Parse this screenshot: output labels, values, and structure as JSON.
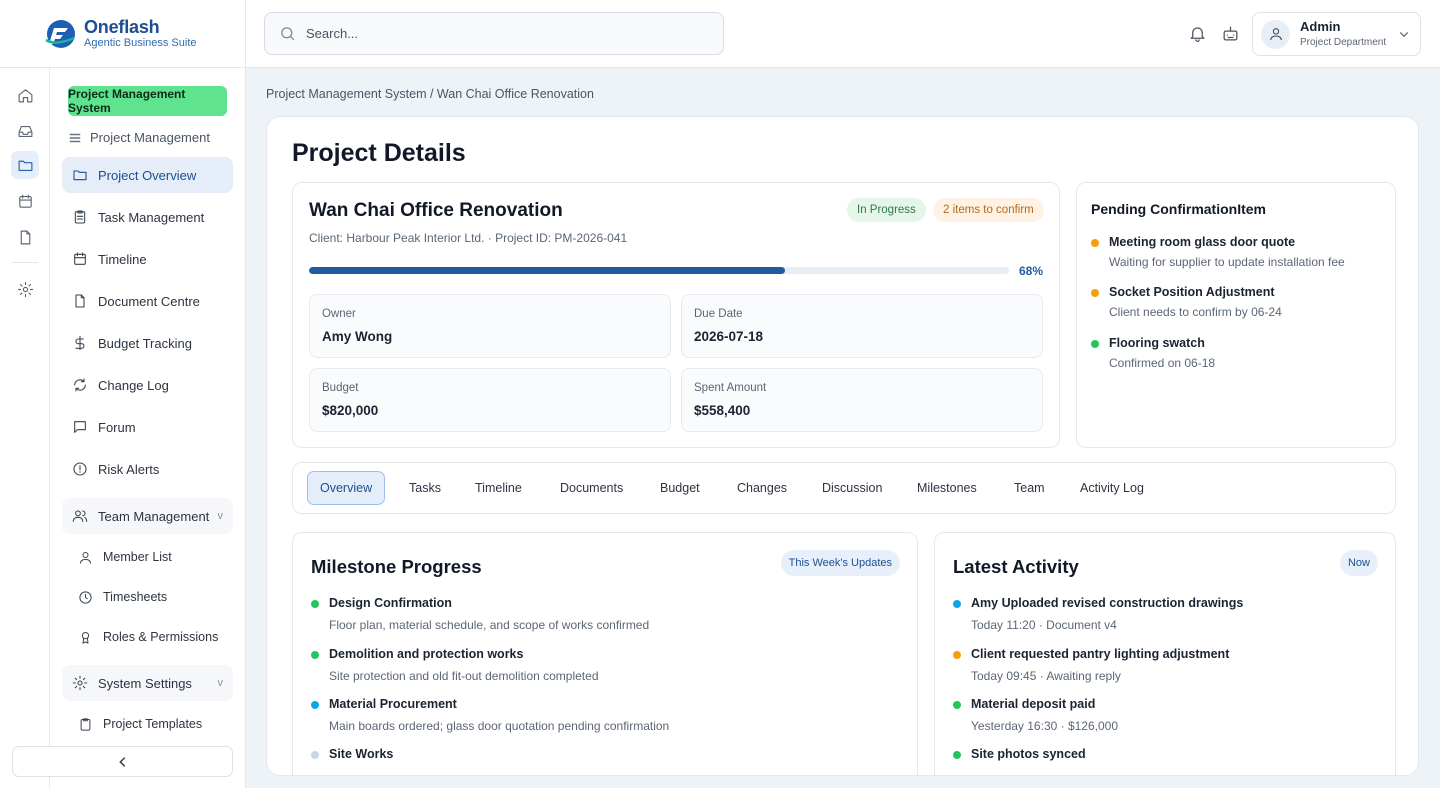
{
  "brand": {
    "name": "Oneflash",
    "tagline": "Agentic Business Suite"
  },
  "search": {
    "placeholder": "Search..."
  },
  "user": {
    "name": "Admin",
    "role": "Project Department"
  },
  "sidebar": {
    "system_badge": "Project Management System",
    "section_title": "Project Management",
    "items": [
      {
        "label": "Project Overview",
        "icon": "folder-icon",
        "active": true
      },
      {
        "label": "Task Management",
        "icon": "clipboard-icon"
      },
      {
        "label": "Timeline",
        "icon": "calendar-icon"
      },
      {
        "label": "Document Centre",
        "icon": "file-icon"
      },
      {
        "label": "Budget Tracking",
        "icon": "dollar-icon"
      },
      {
        "label": "Change Log",
        "icon": "refresh-icon"
      },
      {
        "label": "Forum",
        "icon": "chat-icon"
      },
      {
        "label": "Risk Alerts",
        "icon": "alert-icon"
      }
    ],
    "team_group": {
      "label": "Team Management",
      "chevron": "v",
      "children": [
        "Member List",
        "Timesheets",
        "Roles & Permissions"
      ]
    },
    "settings_group": {
      "label": "System Settings",
      "chevron": "v",
      "children": [
        "Project Templates"
      ]
    }
  },
  "breadcrumb": "Project Management System / Wan Chai Office Renovation",
  "page_title": "Project Details",
  "project": {
    "name": "Wan Chai Office Renovation",
    "meta": "Client: Harbour Peak Interior Ltd. · Project ID: PM-2026-041",
    "status": "In Progress",
    "confirm_badge": "2 items to confirm",
    "progress": 0.68,
    "progress_label": "68%",
    "owner_label": "Owner",
    "owner": "Amy Wong",
    "due_label": "Due Date",
    "due": "2026-07-18",
    "budget_label": "Budget",
    "budget": "$820,000",
    "spent_label": "Spent Amount",
    "spent": "$558,400"
  },
  "pending": {
    "title": "Pending ConfirmationItem",
    "items": [
      {
        "title": "Meeting room glass door quote",
        "sub": "Waiting for supplier to update installation fee",
        "color": "#f59e0b"
      },
      {
        "title": "Socket Position Adjustment",
        "sub": "Client needs to confirm by 06-24",
        "color": "#f59e0b"
      },
      {
        "title": "Flooring swatch",
        "sub": "Confirmed on 06-18",
        "color": "#22c55e"
      }
    ]
  },
  "tabs": [
    "Overview",
    "Tasks",
    "Timeline",
    "Documents",
    "Budget",
    "Changes",
    "Discussion",
    "Milestones",
    "Team",
    "Activity Log"
  ],
  "milestones": {
    "title": "Milestone Progress",
    "badge": "This Week's Updates",
    "items": [
      {
        "title": "Design Confirmation",
        "sub": "Floor plan, material schedule, and scope of works confirmed",
        "color": "#22c55e"
      },
      {
        "title": "Demolition and protection works",
        "sub": "Site protection and old fit-out demolition completed",
        "color": "#22c55e"
      },
      {
        "title": "Material Procurement",
        "sub": "Main boards ordered; glass door quotation pending confirmation",
        "color": "#0ea5e9"
      },
      {
        "title": "Site Works",
        "sub": "",
        "color": "#cbd5e1"
      }
    ]
  },
  "activity": {
    "title": "Latest Activity",
    "badge": "Now",
    "items": [
      {
        "title": "Amy Uploaded revised construction drawings",
        "sub": "Today 11:20 · Document v4",
        "color": "#0ea5e9"
      },
      {
        "title": "Client requested pantry lighting adjustment",
        "sub": "Today 09:45 · Awaiting reply",
        "color": "#f59e0b"
      },
      {
        "title": "Material deposit paid",
        "sub": "Yesterday 16:30 · $126,000",
        "color": "#22c55e"
      },
      {
        "title": "Site photos synced",
        "sub": "",
        "color": "#22c55e"
      }
    ]
  }
}
